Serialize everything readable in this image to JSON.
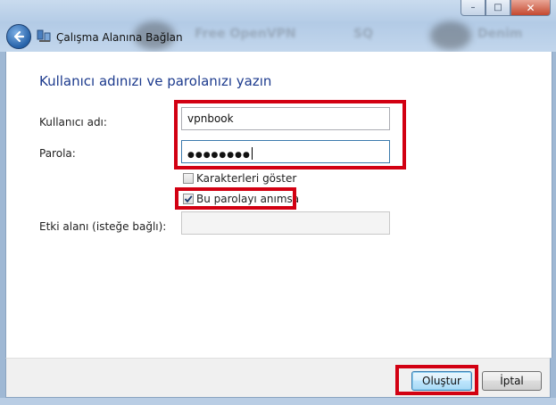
{
  "window": {
    "title": "Çalışma Alanına Bağlan",
    "blurred_tabs": [
      "Free OpenVPN",
      "SQ",
      "Denim"
    ],
    "controls": {
      "minimize": "–",
      "maximize": "□",
      "close": "✕"
    },
    "back_icon": "back-arrow-icon",
    "network_icon": "network-icon"
  },
  "form": {
    "heading": "Kullanıcı adınızı ve parolanızı yazın",
    "username_label": "Kullanıcı adı:",
    "username_value": "vpnbook",
    "password_label": "Parola:",
    "password_mask": "●●●●●●●●",
    "show_chars_label": "Karakterleri göster",
    "show_chars_checked": false,
    "remember_label": "Bu parolayı anımsa",
    "remember_checked": true,
    "domain_label": "Etki alanı (isteğe bağlı):",
    "domain_value": ""
  },
  "buttons": {
    "create": "Oluştur",
    "cancel": "İptal"
  },
  "colors": {
    "highlight": "#d20012",
    "heading": "#1c3a8d"
  }
}
